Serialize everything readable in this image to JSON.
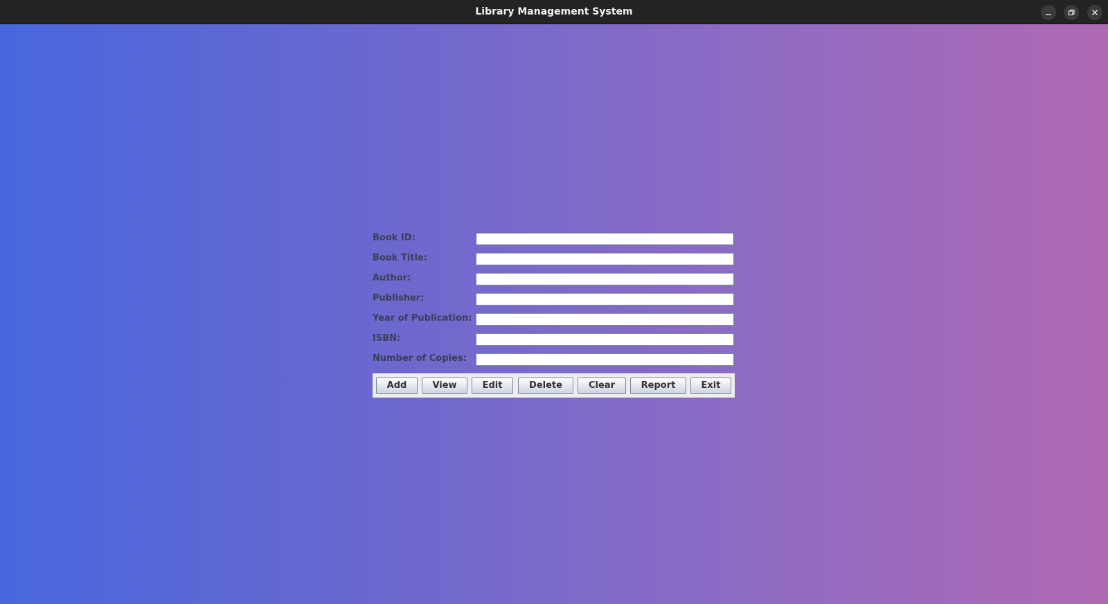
{
  "window": {
    "title": "Library Management System",
    "controls": {
      "minimize_icon": "minimize-icon",
      "maximize_icon": "restore-icon",
      "close_icon": "close-icon"
    }
  },
  "form": {
    "fields": [
      {
        "label": "Book ID:",
        "value": "",
        "focused": true
      },
      {
        "label": "Book Title:",
        "value": ""
      },
      {
        "label": "Author:",
        "value": ""
      },
      {
        "label": "Publisher:",
        "value": ""
      },
      {
        "label": "Year of Publication:",
        "value": ""
      },
      {
        "label": "ISBN:",
        "value": ""
      },
      {
        "label": "Number of Copies:",
        "value": ""
      }
    ]
  },
  "buttons": {
    "add": "Add",
    "view": "View",
    "edit": "Edit",
    "delete": "Delete",
    "clear": "Clear",
    "report": "Report",
    "exit": "Exit"
  },
  "colors": {
    "background_gradient_start": "#4867dd",
    "background_gradient_end": "#b06ab4",
    "titlebar": "#232323",
    "label_text": "#3a3f55"
  }
}
